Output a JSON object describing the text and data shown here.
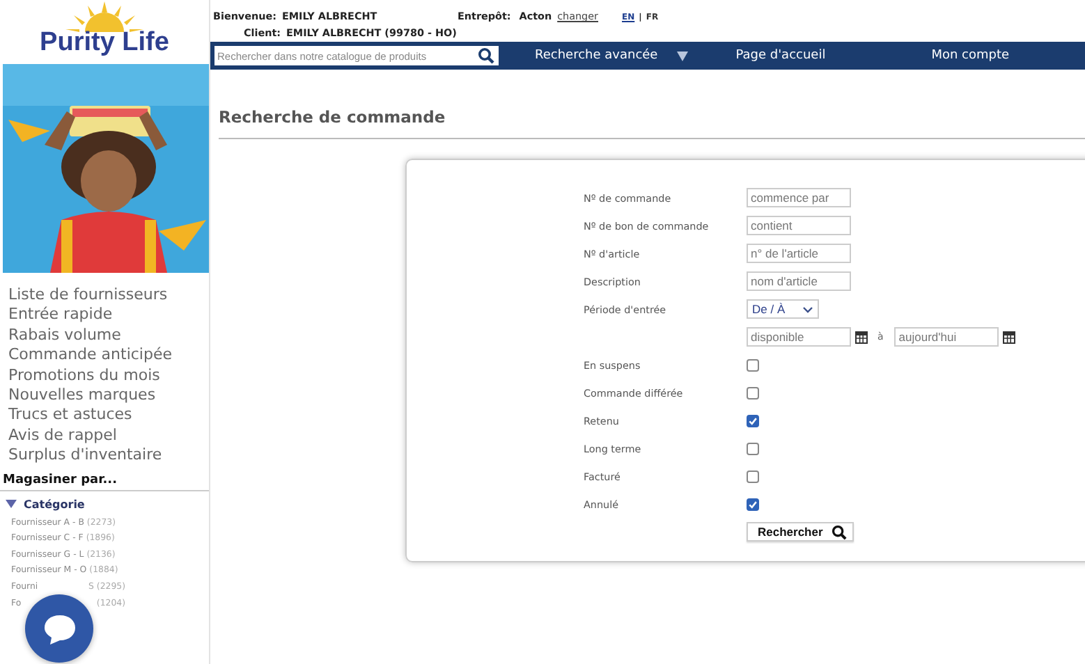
{
  "logo": {
    "text": "Purity Life"
  },
  "header": {
    "greeting_label": "Bienvenue:",
    "user": "EMILY ALBRECHT",
    "client_label": "Client:",
    "client": "EMILY ALBRECHT  (99780 - HO)",
    "warehouse_label": "Entrepôt:",
    "warehouse": "Acton",
    "change_link": "changer",
    "languages": [
      {
        "label": "EN",
        "selected": true
      },
      {
        "label": "FR",
        "selected": false
      }
    ],
    "lang_separator": "|"
  },
  "nav": {
    "search": {
      "placeholder": "Rechercher dans notre catalogue de produits"
    },
    "items": [
      {
        "label": "Recherche avancée",
        "dropdown": true
      },
      {
        "label": "Page d'accueil",
        "dropdown": false
      },
      {
        "label": "Mon compte",
        "dropdown": false
      }
    ]
  },
  "sidebar": {
    "links": [
      "Liste de fournisseurs",
      "Entrée rapide",
      "Rabais volume",
      "Commande anticipée",
      "Promotions du mois",
      "Nouvelles marques",
      "Trucs et astuces",
      "Avis de rappel",
      "Surplus d'inventaire"
    ],
    "shop_by": "Magasiner par...",
    "category": {
      "label": "Catégorie",
      "expanded": true,
      "items": [
        {
          "label": "Fournisseur A - B",
          "count": "(2273)",
          "covered": false
        },
        {
          "label": "Fournisseur C - F",
          "count": "(1896)",
          "covered": false
        },
        {
          "label": "Fournisseur G - L",
          "count": "(2136)",
          "covered": false
        },
        {
          "label": "Fournisseur M - O",
          "count": "(1884)",
          "covered": false
        },
        {
          "label": "Fourni",
          "count": "S (2295)",
          "covered": true
        },
        {
          "label": "Fo",
          "count": "(1204)",
          "covered": true
        }
      ]
    }
  },
  "page_title": "Recherche de commande",
  "form": {
    "rows": [
      {
        "kind": "text",
        "label": "Nº de commande",
        "placeholder": "commence par"
      },
      {
        "kind": "text",
        "label": "Nº de bon de commande",
        "placeholder": "contient"
      },
      {
        "kind": "text",
        "label": "Nº d'article",
        "placeholder": "n° de l'article"
      },
      {
        "kind": "text",
        "label": "Description",
        "placeholder": "nom d'article"
      },
      {
        "kind": "select",
        "label": "Période d'entrée",
        "value": "De / À"
      },
      {
        "kind": "daterange",
        "from_placeholder": "disponible",
        "separator": "à",
        "to_placeholder": "aujourd'hui"
      },
      {
        "kind": "checkbox",
        "label": "En suspens",
        "checked": false
      },
      {
        "kind": "checkbox",
        "label": "Commande différée",
        "checked": false
      },
      {
        "kind": "checkbox",
        "label": "Retenu",
        "checked": true
      },
      {
        "kind": "checkbox",
        "label": "Long terme",
        "checked": false
      },
      {
        "kind": "checkbox",
        "label": "Facturé",
        "checked": false
      },
      {
        "kind": "checkbox",
        "label": "Annulé",
        "checked": true
      },
      {
        "kind": "button",
        "label": "Rechercher"
      }
    ]
  },
  "chat": {
    "kind": "chat-button"
  }
}
